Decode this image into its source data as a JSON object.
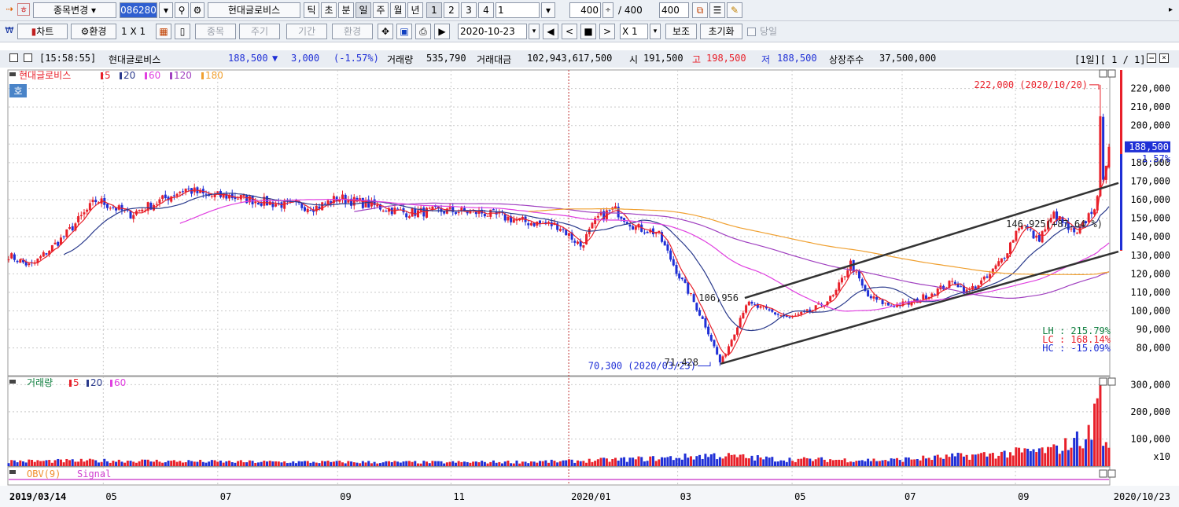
{
  "toolbar1": {
    "stock_change": "종목변경",
    "code": "086280",
    "name": "현대글로비스",
    "periods": [
      "틱",
      "초",
      "분",
      "일",
      "주",
      "월",
      "년"
    ],
    "selected_period": "일",
    "numbers": [
      "1",
      "2",
      "3",
      "4"
    ],
    "count_value": "1",
    "display_count": "400",
    "total_count": "/ 400",
    "count_box": "400"
  },
  "toolbar2": {
    "chart": "차트",
    "env": "환경",
    "layout": "1 X 1",
    "item": "종목",
    "cycle": "주기",
    "period": "기간",
    "env2": "환경",
    "date": "2020-10-23",
    "multiplier": "X 1",
    "aux": "보조",
    "reset": "초기화",
    "today": "당일"
  },
  "info": {
    "time": "[15:58:55]",
    "name": "현대글로비스",
    "price": "188,500",
    "change_arrow": "▼",
    "change": "3,000",
    "change_pct": "(-1.57%)",
    "volume_label": "거래량",
    "volume": "535,790",
    "amount_label": "거래대금",
    "amount": "102,943,617,500",
    "open_label": "시",
    "open": "191,500",
    "high_label": "고",
    "high": "198,500",
    "low_label": "저",
    "low": "188,500",
    "shares_label": "상장주수",
    "shares": "37,500,000",
    "page": "[1일][ 1 / 1]"
  },
  "colors": {
    "up": "#e8202a",
    "down": "#1f2fd6",
    "ma5": "#e8202a",
    "ma20": "#2a3a8c",
    "ma60": "#e040e0",
    "ma120": "#a040c0",
    "ma180": "#f0a030",
    "channel": "#333333",
    "grid": "#c9c9c9",
    "lh": "#108040"
  },
  "chart_data": [
    {
      "type": "candlestick",
      "title": "현대글로비스",
      "legend": [
        "5",
        "20",
        "60",
        "120",
        "180"
      ],
      "label_box": "호",
      "y_ticks": [
        80000,
        90000,
        100000,
        110000,
        120000,
        130000,
        140000,
        150000,
        160000,
        170000,
        180000,
        190000,
        200000,
        210000,
        220000
      ],
      "y_tick_labels": [
        "80,000",
        "90,000",
        "100,000",
        "110,000",
        "120,000",
        "130,000",
        "140,000",
        "150,000",
        "160,000",
        "170,000",
        "180,000",
        "190,000",
        "200,000",
        "210,000",
        "220,000"
      ],
      "ylim": [
        65000,
        230000
      ],
      "x_ticks": [
        "2019/03/14",
        "05",
        "07",
        "09",
        "11",
        "2020/01",
        "03",
        "05",
        "07",
        "09",
        "2020/10/23"
      ],
      "x_tick_pos": [
        0.0,
        0.086,
        0.19,
        0.299,
        0.402,
        0.509,
        0.608,
        0.712,
        0.812,
        0.915,
        1.0
      ],
      "close_series": [
        [
          0.0,
          130000
        ],
        [
          0.02,
          124000
        ],
        [
          0.05,
          140000
        ],
        [
          0.08,
          160000
        ],
        [
          0.11,
          152000
        ],
        [
          0.14,
          160000
        ],
        [
          0.16,
          166000
        ],
        [
          0.18,
          162000
        ],
        [
          0.2,
          162000
        ],
        [
          0.24,
          158000
        ],
        [
          0.28,
          156000
        ],
        [
          0.3,
          161000
        ],
        [
          0.33,
          157000
        ],
        [
          0.36,
          153000
        ],
        [
          0.4,
          154000
        ],
        [
          0.43,
          153000
        ],
        [
          0.47,
          148000
        ],
        [
          0.5,
          146000
        ],
        [
          0.52,
          135000
        ],
        [
          0.535,
          150000
        ],
        [
          0.55,
          155000
        ],
        [
          0.57,
          145000
        ],
        [
          0.59,
          142000
        ],
        [
          0.6,
          130000
        ],
        [
          0.61,
          118000
        ],
        [
          0.62,
          108000
        ],
        [
          0.635,
          90000
        ],
        [
          0.647,
          71428
        ],
        [
          0.655,
          82000
        ],
        [
          0.67,
          104000
        ],
        [
          0.69,
          100000
        ],
        [
          0.71,
          96000
        ],
        [
          0.73,
          100000
        ],
        [
          0.75,
          108000
        ],
        [
          0.765,
          126000
        ],
        [
          0.78,
          108000
        ],
        [
          0.8,
          103000
        ],
        [
          0.82,
          104000
        ],
        [
          0.84,
          110000
        ],
        [
          0.86,
          116000
        ],
        [
          0.87,
          110000
        ],
        [
          0.89,
          118000
        ],
        [
          0.905,
          130000
        ],
        [
          0.92,
          148000
        ],
        [
          0.935,
          138000
        ],
        [
          0.95,
          152000
        ],
        [
          0.97,
          140000
        ],
        [
          0.99,
          160000
        ],
        [
          1.0,
          188500
        ]
      ],
      "max_label": "222,000 (2020/10/20)",
      "max_value": 222000,
      "min_label": "70,300 (2020/03/23)",
      "min_value": 70300,
      "low_label": "71,428",
      "mid_label": "106,956",
      "right_label": "146,925(+87.64 %)",
      "last_price": "188,500",
      "last_pct": "-1.57%",
      "stats": [
        "LH : 215.79%",
        "LC : 168.14%",
        "HC : -15.09%"
      ]
    },
    {
      "type": "bar",
      "title": "거래량",
      "legend": [
        "5",
        "20",
        "60"
      ],
      "y_ticks": [
        100000,
        200000,
        300000
      ],
      "y_tick_labels": [
        "100,000",
        "200,000",
        "300,000"
      ],
      "y_unit": "x10",
      "ylim": [
        0,
        330000
      ],
      "values": [
        [
          0.0,
          18000
        ],
        [
          0.1,
          20000
        ],
        [
          0.2,
          16000
        ],
        [
          0.3,
          15000
        ],
        [
          0.4,
          14000
        ],
        [
          0.5,
          17000
        ],
        [
          0.6,
          30000
        ],
        [
          0.64,
          40000
        ],
        [
          0.7,
          25000
        ],
        [
          0.8,
          22000
        ],
        [
          0.86,
          35000
        ],
        [
          0.9,
          45000
        ],
        [
          0.95,
          60000
        ],
        [
          0.985,
          120000
        ],
        [
          0.99,
          320000
        ],
        [
          0.995,
          90000
        ],
        [
          1.0,
          54000
        ]
      ]
    },
    {
      "type": "line",
      "title": "OBV(9)",
      "legend": [
        "Signal"
      ]
    }
  ]
}
